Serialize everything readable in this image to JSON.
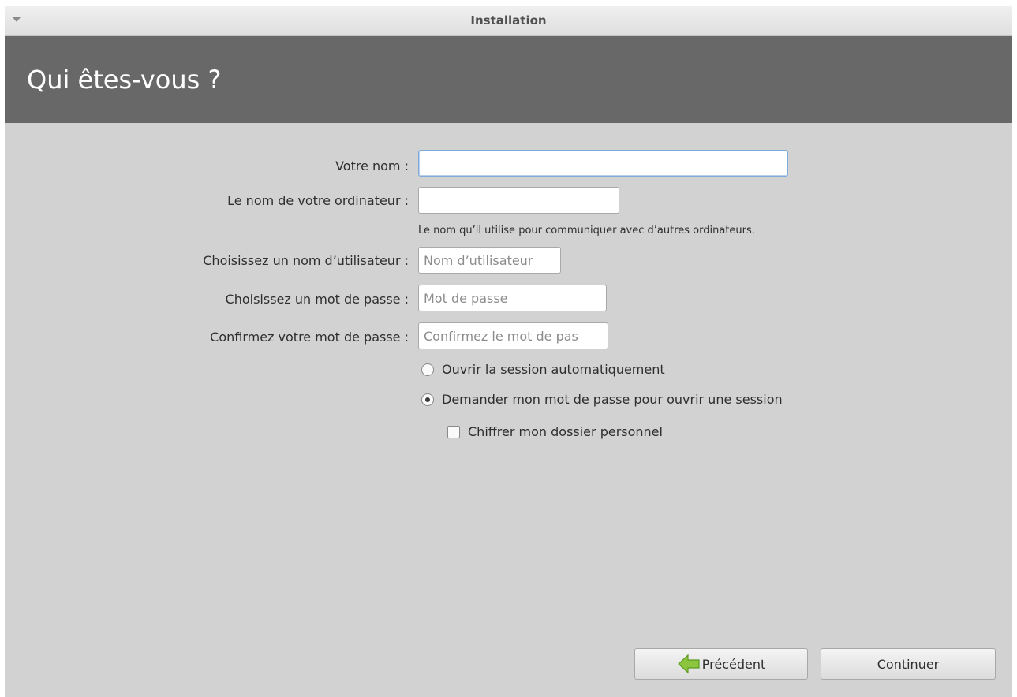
{
  "window": {
    "title": "Installation"
  },
  "page": {
    "title": "Qui êtes-vous ?"
  },
  "form": {
    "name_label": "Votre nom :",
    "name_value": "",
    "computer_label": "Le nom de votre ordinateur :",
    "computer_value": "",
    "computer_hint": "Le nom qu’il utilise pour communiquer avec d’autres ordinateurs.",
    "username_label": "Choisissez un nom d’utilisateur :",
    "username_placeholder": "Nom d’utilisateur",
    "password_label": "Choisissez un mot de passe :",
    "password_placeholder": "Mot de passe",
    "confirm_label": "Confirmez votre mot de passe :",
    "confirm_placeholder": "Confirmez le mot de pas"
  },
  "options": {
    "auto_login": "Ouvrir la session automatiquement",
    "ask_password": "Demander mon mot de passe pour ouvrir une session",
    "encrypt_home": "Chiffrer mon dossier personnel",
    "selected": "ask_password",
    "encrypt_checked": false
  },
  "buttons": {
    "back": "Précédent",
    "next": "Continuer"
  },
  "icons": {
    "menu": "menu-arrow-icon",
    "back": "back-arrow-icon"
  },
  "colors": {
    "header_bg": "#686868",
    "window_bg": "#d2d2d2",
    "back_arrow": "#8cc63e"
  }
}
